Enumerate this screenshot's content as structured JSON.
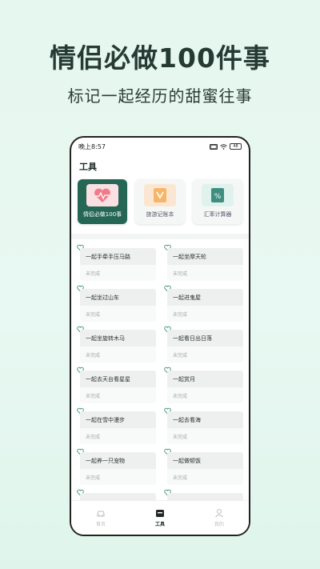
{
  "promo": {
    "title": "情侣必做100件事",
    "subtitle": "标记一起经历的甜蜜往事"
  },
  "status_bar": {
    "time": "晚上8:57",
    "battery": "48"
  },
  "section_title": "工具",
  "tools": [
    {
      "label": "情侣必做100事",
      "icon": "heart-pulse-icon",
      "active": true
    },
    {
      "label": "旅游记账本",
      "icon": "book-v-icon",
      "active": false
    },
    {
      "label": "汇率计算器",
      "icon": "calculator-icon",
      "active": false
    }
  ],
  "items": [
    {
      "title": "一起手牵手压马路",
      "status": "未完成"
    },
    {
      "title": "一起坐摩天轮",
      "status": "未完成"
    },
    {
      "title": "一起坐过山车",
      "status": "未完成"
    },
    {
      "title": "一起进鬼屋",
      "status": "未完成"
    },
    {
      "title": "一起坐旋转木马",
      "status": "未完成"
    },
    {
      "title": "一起看日出日落",
      "status": "未完成"
    },
    {
      "title": "一起去天台看星星",
      "status": "未完成"
    },
    {
      "title": "一起赏月",
      "status": "未完成"
    },
    {
      "title": "一起在雪中漫步",
      "status": "未完成"
    },
    {
      "title": "一起去看海",
      "status": "未完成"
    },
    {
      "title": "一起养一只宠物",
      "status": "未完成"
    },
    {
      "title": "一起做顿饭",
      "status": "未完成"
    },
    {
      "title": "",
      "status": ""
    },
    {
      "title": "",
      "status": ""
    }
  ],
  "tab_bar": {
    "tabs": [
      {
        "label": "首页",
        "icon": "car-icon"
      },
      {
        "label": "工具",
        "icon": "toolbox-icon"
      },
      {
        "label": "我的",
        "icon": "user-icon"
      }
    ]
  },
  "colors": {
    "accent": "#256655",
    "background": "#e6f7ef",
    "heart": "#3a8c6e"
  }
}
